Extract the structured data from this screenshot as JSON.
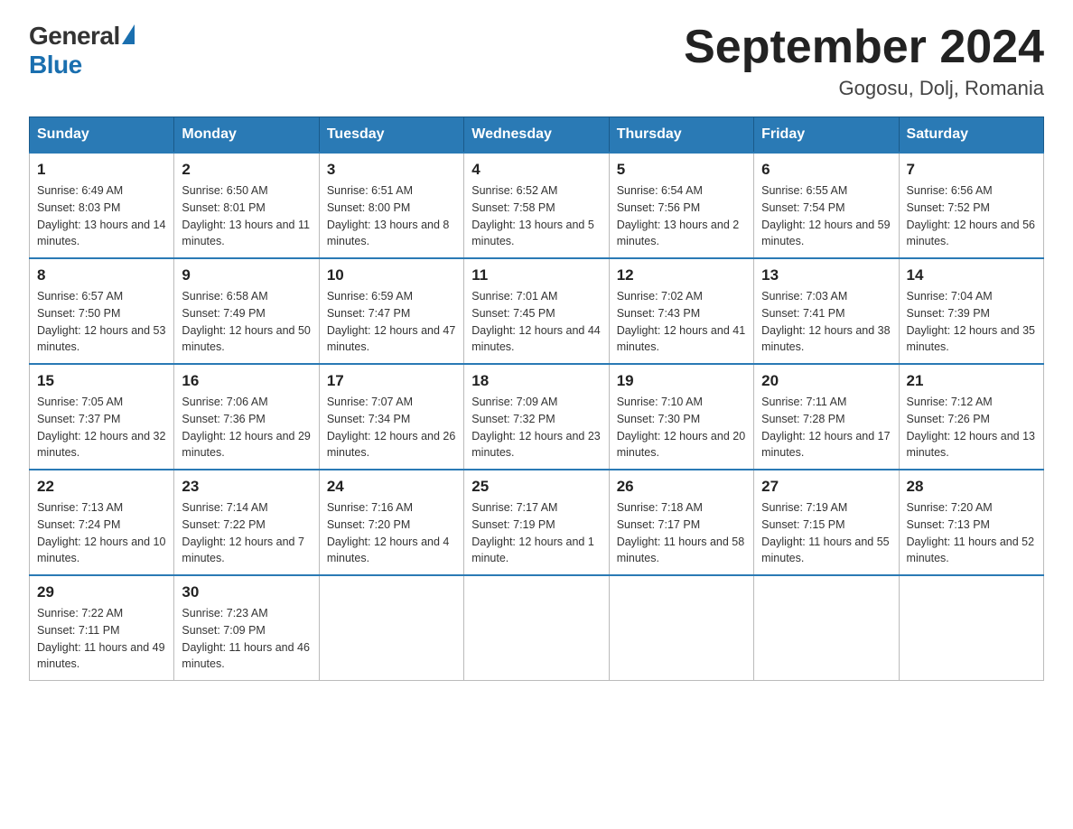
{
  "header": {
    "logo_text_black": "General",
    "logo_text_blue": "Blue",
    "month_title": "September 2024",
    "location": "Gogosu, Dolj, Romania"
  },
  "days_of_week": [
    "Sunday",
    "Monday",
    "Tuesday",
    "Wednesday",
    "Thursday",
    "Friday",
    "Saturday"
  ],
  "weeks": [
    [
      {
        "day": "1",
        "sunrise": "6:49 AM",
        "sunset": "8:03 PM",
        "daylight": "13 hours and 14 minutes."
      },
      {
        "day": "2",
        "sunrise": "6:50 AM",
        "sunset": "8:01 PM",
        "daylight": "13 hours and 11 minutes."
      },
      {
        "day": "3",
        "sunrise": "6:51 AM",
        "sunset": "8:00 PM",
        "daylight": "13 hours and 8 minutes."
      },
      {
        "day": "4",
        "sunrise": "6:52 AM",
        "sunset": "7:58 PM",
        "daylight": "13 hours and 5 minutes."
      },
      {
        "day": "5",
        "sunrise": "6:54 AM",
        "sunset": "7:56 PM",
        "daylight": "13 hours and 2 minutes."
      },
      {
        "day": "6",
        "sunrise": "6:55 AM",
        "sunset": "7:54 PM",
        "daylight": "12 hours and 59 minutes."
      },
      {
        "day": "7",
        "sunrise": "6:56 AM",
        "sunset": "7:52 PM",
        "daylight": "12 hours and 56 minutes."
      }
    ],
    [
      {
        "day": "8",
        "sunrise": "6:57 AM",
        "sunset": "7:50 PM",
        "daylight": "12 hours and 53 minutes."
      },
      {
        "day": "9",
        "sunrise": "6:58 AM",
        "sunset": "7:49 PM",
        "daylight": "12 hours and 50 minutes."
      },
      {
        "day": "10",
        "sunrise": "6:59 AM",
        "sunset": "7:47 PM",
        "daylight": "12 hours and 47 minutes."
      },
      {
        "day": "11",
        "sunrise": "7:01 AM",
        "sunset": "7:45 PM",
        "daylight": "12 hours and 44 minutes."
      },
      {
        "day": "12",
        "sunrise": "7:02 AM",
        "sunset": "7:43 PM",
        "daylight": "12 hours and 41 minutes."
      },
      {
        "day": "13",
        "sunrise": "7:03 AM",
        "sunset": "7:41 PM",
        "daylight": "12 hours and 38 minutes."
      },
      {
        "day": "14",
        "sunrise": "7:04 AM",
        "sunset": "7:39 PM",
        "daylight": "12 hours and 35 minutes."
      }
    ],
    [
      {
        "day": "15",
        "sunrise": "7:05 AM",
        "sunset": "7:37 PM",
        "daylight": "12 hours and 32 minutes."
      },
      {
        "day": "16",
        "sunrise": "7:06 AM",
        "sunset": "7:36 PM",
        "daylight": "12 hours and 29 minutes."
      },
      {
        "day": "17",
        "sunrise": "7:07 AM",
        "sunset": "7:34 PM",
        "daylight": "12 hours and 26 minutes."
      },
      {
        "day": "18",
        "sunrise": "7:09 AM",
        "sunset": "7:32 PM",
        "daylight": "12 hours and 23 minutes."
      },
      {
        "day": "19",
        "sunrise": "7:10 AM",
        "sunset": "7:30 PM",
        "daylight": "12 hours and 20 minutes."
      },
      {
        "day": "20",
        "sunrise": "7:11 AM",
        "sunset": "7:28 PM",
        "daylight": "12 hours and 17 minutes."
      },
      {
        "day": "21",
        "sunrise": "7:12 AM",
        "sunset": "7:26 PM",
        "daylight": "12 hours and 13 minutes."
      }
    ],
    [
      {
        "day": "22",
        "sunrise": "7:13 AM",
        "sunset": "7:24 PM",
        "daylight": "12 hours and 10 minutes."
      },
      {
        "day": "23",
        "sunrise": "7:14 AM",
        "sunset": "7:22 PM",
        "daylight": "12 hours and 7 minutes."
      },
      {
        "day": "24",
        "sunrise": "7:16 AM",
        "sunset": "7:20 PM",
        "daylight": "12 hours and 4 minutes."
      },
      {
        "day": "25",
        "sunrise": "7:17 AM",
        "sunset": "7:19 PM",
        "daylight": "12 hours and 1 minute."
      },
      {
        "day": "26",
        "sunrise": "7:18 AM",
        "sunset": "7:17 PM",
        "daylight": "11 hours and 58 minutes."
      },
      {
        "day": "27",
        "sunrise": "7:19 AM",
        "sunset": "7:15 PM",
        "daylight": "11 hours and 55 minutes."
      },
      {
        "day": "28",
        "sunrise": "7:20 AM",
        "sunset": "7:13 PM",
        "daylight": "11 hours and 52 minutes."
      }
    ],
    [
      {
        "day": "29",
        "sunrise": "7:22 AM",
        "sunset": "7:11 PM",
        "daylight": "11 hours and 49 minutes."
      },
      {
        "day": "30",
        "sunrise": "7:23 AM",
        "sunset": "7:09 PM",
        "daylight": "11 hours and 46 minutes."
      },
      null,
      null,
      null,
      null,
      null
    ]
  ]
}
